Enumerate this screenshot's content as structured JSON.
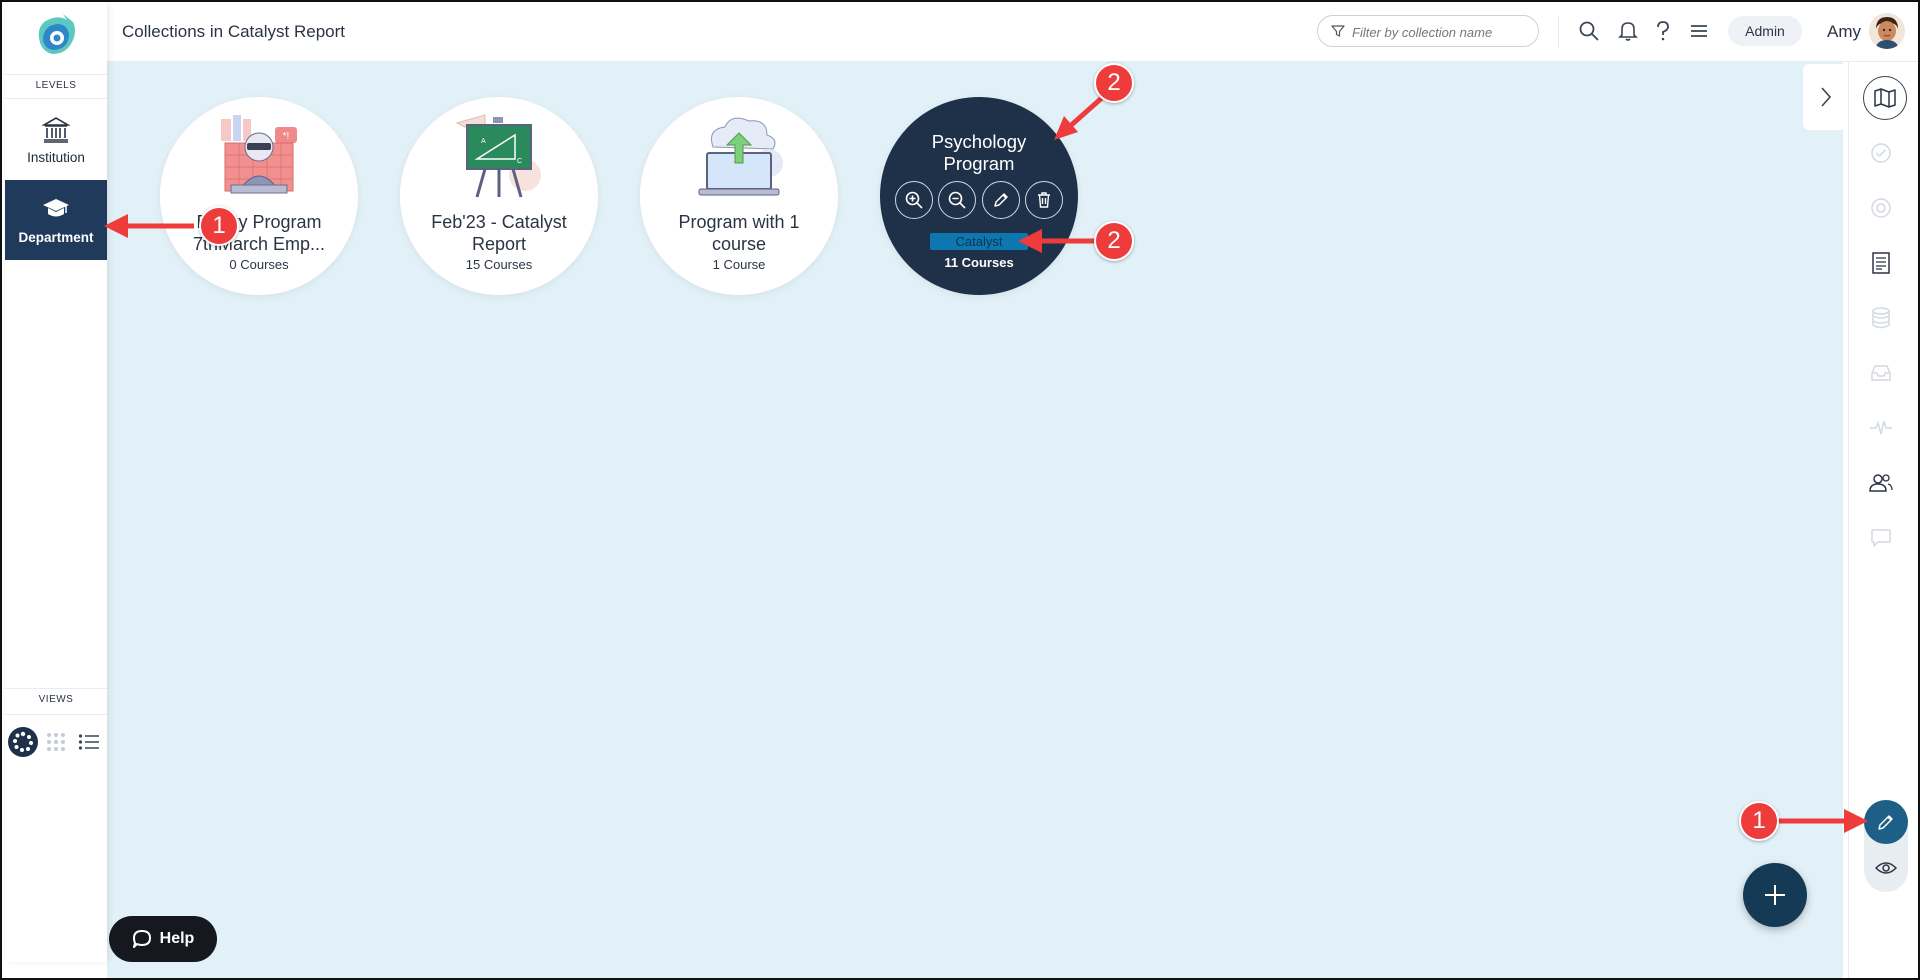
{
  "header": {
    "title": "Collections in Catalyst Report",
    "filter_placeholder": "Filter by collection name",
    "role": "Admin",
    "user_name": "Amy"
  },
  "sidebar": {
    "levels_label": "LEVELS",
    "views_label": "VIEWS",
    "levels": [
      {
        "label": "Institution",
        "icon": "institution-icon",
        "active": false
      },
      {
        "label": "Department",
        "icon": "graduation-cap-icon",
        "active": true
      }
    ],
    "views": [
      {
        "icon": "circle-view-icon",
        "active": true
      },
      {
        "icon": "grid-view-icon",
        "active": false
      },
      {
        "icon": "list-view-icon",
        "active": false
      }
    ]
  },
  "collections": [
    {
      "name": "Empty Program 7thMarch Emp...",
      "count": "0 Courses",
      "illustration": "hacker-illustration"
    },
    {
      "name": "Feb'23 - Catalyst Report",
      "count": "15 Courses",
      "illustration": "chalkboard-illustration"
    },
    {
      "name": "Program with 1 course",
      "count": "1 Course",
      "illustration": "cloud-upload-illustration"
    },
    {
      "name": "Psychology Program",
      "count": "11 Courses",
      "tag": "Catalyst",
      "selected": true
    }
  ],
  "selected_actions": [
    "zoom-in-icon",
    "zoom-out-icon",
    "pencil-icon",
    "trash-icon"
  ],
  "help_label": "Help",
  "annotations": [
    "1",
    "1",
    "2",
    "2"
  ],
  "colors": {
    "navy": "#1f3149",
    "canvas": "#e2f0f7",
    "accent": "#1d5f86",
    "annotation_red": "#ee3b3b",
    "tag_blue": "#0e77b0"
  }
}
